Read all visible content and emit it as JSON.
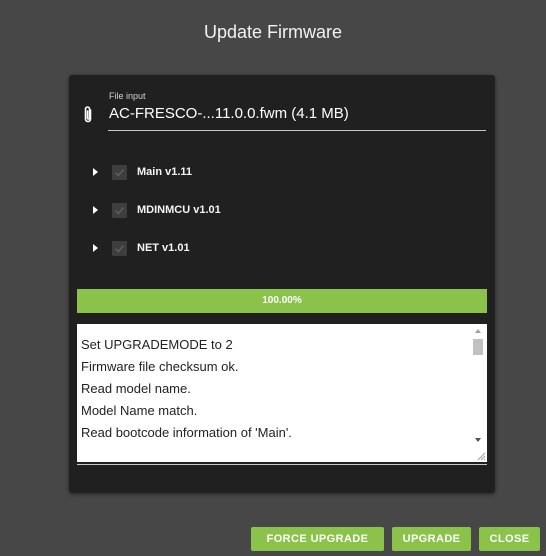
{
  "dialog": {
    "title": "Update Firmware"
  },
  "file_input": {
    "label": "File input",
    "value": "AC-FRESCO-...11.0.0.fwm (4.1 MB)",
    "icon": "paperclip-icon"
  },
  "modules": [
    {
      "label": "Main v1.11",
      "checked": true
    },
    {
      "label": "MDINMCU v1.01",
      "checked": true
    },
    {
      "label": "NET v1.01",
      "checked": true
    }
  ],
  "progress": {
    "percent": 100,
    "label": "100.00%"
  },
  "log": {
    "lines": [
      "Set UPGRADEMODE to 2",
      "Firmware file checksum ok.",
      "Read model name.",
      "Model Name match.",
      "Read bootcode information of 'Main'."
    ]
  },
  "buttons": {
    "force_upgrade": "FORCE UPGRADE",
    "upgrade": "UPGRADE",
    "close": "CLOSE"
  },
  "colors": {
    "accent": "#8bc34a",
    "background": "#474747",
    "panel": "#202020"
  }
}
